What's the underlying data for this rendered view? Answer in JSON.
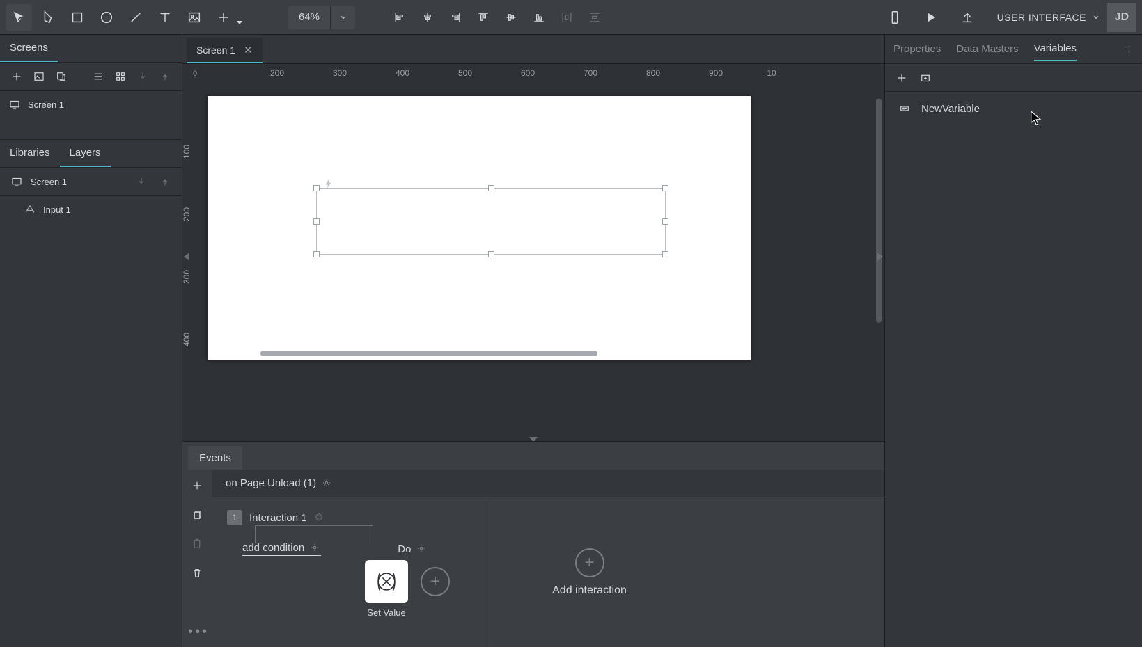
{
  "toolbar": {
    "zoom": "64%",
    "mode_label": "USER INTERFACE",
    "avatar": "JD"
  },
  "sidebar": {
    "screens_title": "Screens",
    "screens": [
      "Screen 1"
    ],
    "libraries_tab": "Libraries",
    "layers_tab": "Layers",
    "layer_root": "Screen 1",
    "layer_children": [
      "Input 1"
    ]
  },
  "document": {
    "tab_name": "Screen 1"
  },
  "ruler": {
    "h_ticks": [
      "200",
      "300",
      "400",
      "500",
      "600",
      "700",
      "800",
      "900",
      "10"
    ],
    "v_ticks": [
      "100",
      "200",
      "300",
      "400"
    ],
    "corner": "0"
  },
  "events": {
    "panel_title": "Events",
    "trigger": "on Page Unload (1)",
    "interaction": "Interaction 1",
    "interaction_index": "1",
    "add_condition": "add condition",
    "do_label": "Do",
    "action_tile": "Set Value",
    "add_interaction": "Add interaction"
  },
  "right": {
    "tabs": {
      "properties": "Properties",
      "data_masters": "Data Masters",
      "variables": "Variables"
    },
    "variables": [
      "NewVariable"
    ]
  }
}
